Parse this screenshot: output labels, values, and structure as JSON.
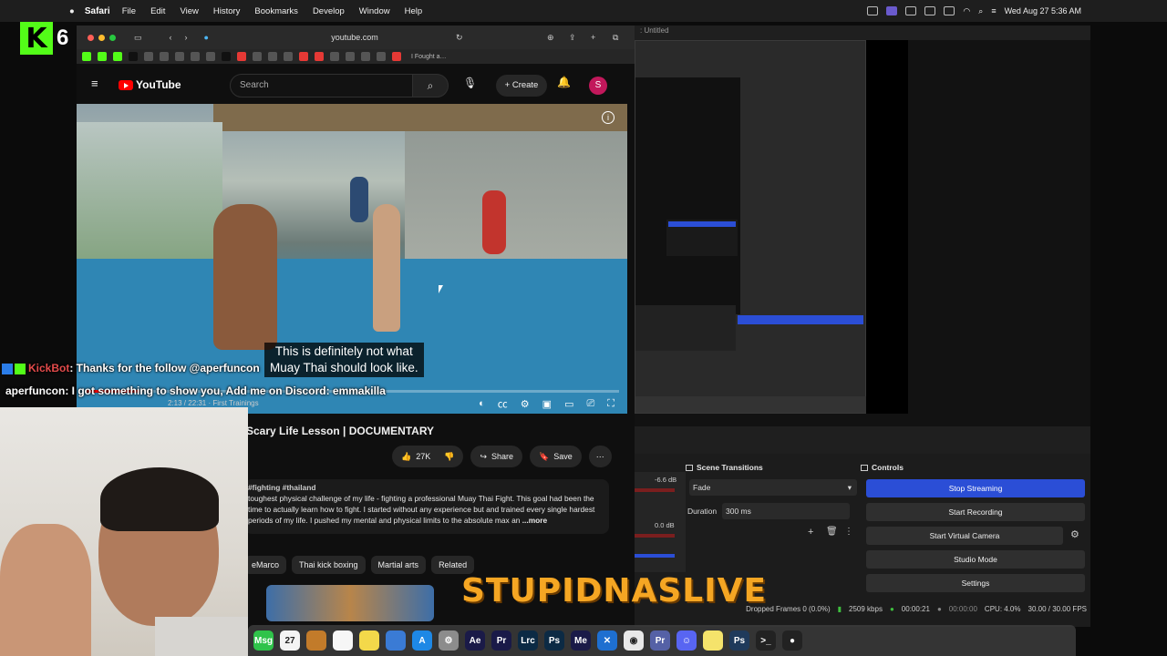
{
  "menubar": {
    "app_name": "Safari",
    "menus": [
      "File",
      "Edit",
      "View",
      "History",
      "Bookmarks",
      "Develop",
      "Window",
      "Help"
    ],
    "clock": "Wed Aug 27  5:36 AM"
  },
  "kick": {
    "logo_letter": "K",
    "count": "6"
  },
  "safari": {
    "url": "youtube.com",
    "tab_label": "I Fought a…",
    "favorites_icons": [
      "kick-icon",
      "kick-icon",
      "kick-icon",
      "x-icon",
      "generic-icon",
      "generic-icon",
      "generic-icon",
      "generic-icon",
      "generic-icon",
      "x-icon",
      "youtube-icon",
      "chrome-icon",
      "chrome-icon",
      "generic-icon",
      "youtube-icon",
      "youtube-icon",
      "generic-icon",
      "generic-icon",
      "generic-icon",
      "generic-icon",
      "youtube-icon"
    ]
  },
  "youtube": {
    "logo": "YouTube",
    "search_placeholder": "Search",
    "create_label": "Create",
    "avatar_letter": "S",
    "video": {
      "caption_line1": "This is definitely not what",
      "caption_line2": "Muay Thai should look like.",
      "time": "2:13 / 22:31 · First Trainings",
      "progress": 0.1
    },
    "title": "Scary Life Lesson | DOCUMENTARY",
    "likes": "27K",
    "share_label": "Share",
    "save_label": "Save",
    "desc_tags": "#fighting #thailand",
    "desc_text": "toughest physical challenge of my life - fighting a professional Muay Thai Fight. This goal had been the time to actually learn how to fight. I started without any experience but and trained every single hardest periods of my life. I pushed my mental and physical limits to the absolute max an",
    "desc_more": "...more",
    "chips": [
      "eMarco",
      "Thai kick boxing",
      "Martial arts",
      "Related"
    ]
  },
  "chat": {
    "line1_user": "KickBot",
    "line1_text": ": Thanks for the follow @aperfuncon",
    "line2_user": "aperfuncon",
    "line2_text": ": I got something to show you, Add me on Discord: emmakilla"
  },
  "obs": {
    "window_title": ": Untitled",
    "scene_transitions_label": "Scene Transitions",
    "controls_label": "Controls",
    "transition_value": "Fade",
    "duration_label": "Duration",
    "duration_value": "300 ms",
    "buttons": [
      "Stop Streaming",
      "Start Recording",
      "Start Virtual Camera",
      "Studio Mode",
      "Settings"
    ],
    "mixer_db1": "-6.6 dB",
    "mixer_db2": "0.0 dB",
    "status_dropped": "Dropped Frames 0 (0.0%)",
    "status_kbps": "2509 kbps",
    "status_time": "00:00:21",
    "status_rec": "00:00:00",
    "status_cpu": "CPU: 4.0%",
    "status_fps": "30.00 / 30.00 FPS"
  },
  "overlay": {
    "brand": "STUPIDNASLIVE"
  },
  "dock": {
    "apps": [
      {
        "label": "Msg",
        "color": "#2fc34a",
        "name": "messages-icon"
      },
      {
        "label": "27",
        "color": "#f4f4f4",
        "name": "calendar-icon"
      },
      {
        "label": "",
        "color": "#c27b2a",
        "name": "folder-icon"
      },
      {
        "label": "",
        "color": "#f6f6f6",
        "name": "reminders-icon"
      },
      {
        "label": "",
        "color": "#f3d84a",
        "name": "notes-icon"
      },
      {
        "label": "",
        "color": "#3a7bd5",
        "name": "freeform-icon"
      },
      {
        "label": "A",
        "color": "#1e88e5",
        "name": "appstore-icon"
      },
      {
        "label": "⚙",
        "color": "#8c8c8c",
        "name": "settings-icon"
      },
      {
        "label": "Ae",
        "color": "#1a1a48",
        "name": "aftereffects-icon"
      },
      {
        "label": "Pr",
        "color": "#1a1a48",
        "name": "premiere-icon"
      },
      {
        "label": "Lrc",
        "color": "#0c2a44",
        "name": "lightroom-icon"
      },
      {
        "label": "Ps",
        "color": "#0c2a44",
        "name": "photoshop-icon"
      },
      {
        "label": "Me",
        "color": "#1a1a48",
        "name": "mediaencoder-icon"
      },
      {
        "label": "✕",
        "color": "#1e6fd0",
        "name": "vscode-icon"
      },
      {
        "label": "◉",
        "color": "#e8e8e8",
        "name": "chrome-icon"
      },
      {
        "label": "Pr",
        "color": "#5561a6",
        "name": "preview-icon"
      },
      {
        "label": "☺",
        "color": "#5865f2",
        "name": "discord-icon"
      },
      {
        "label": "",
        "color": "#f5e36b",
        "name": "stickies-icon"
      },
      {
        "label": "Ps",
        "color": "#1f3a5b",
        "name": "photoshop2-icon"
      },
      {
        "label": ">_",
        "color": "#222",
        "name": "terminal-icon"
      },
      {
        "label": "●",
        "color": "#222",
        "name": "obs-icon"
      }
    ]
  }
}
